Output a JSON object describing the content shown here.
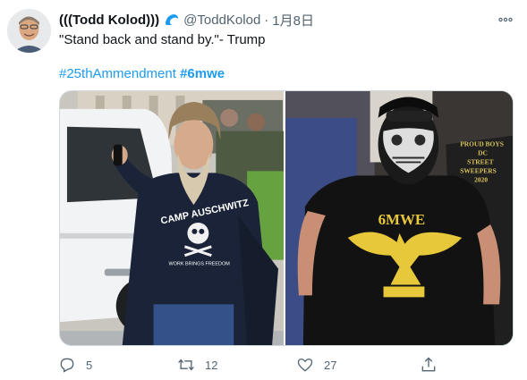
{
  "tweet": {
    "display_name": "(((Todd Kolod)))",
    "handle": "@ToddKolod",
    "separator": "·",
    "date": "1月8日",
    "text": "\"Stand back and stand by.\"- Trump",
    "hashtags": [
      "#25thAmmendment",
      "#6mwe"
    ],
    "more_icon": "more-dots-icon",
    "badge_icon": "wave-emoji-icon"
  },
  "media": {
    "left_photo": {
      "shirt_text_line1": "CAMP AUSCHWITZ",
      "shirt_text_line2": "WORK BRINGS FREEDOM"
    },
    "right_photo": {
      "shirt_text": "6MWE",
      "background_shirt_text": [
        "PROUD BOYS",
        "DC",
        "STREET",
        "SWEEPERS",
        "2020"
      ]
    }
  },
  "actions": {
    "reply_count": "5",
    "retweet_count": "12",
    "like_count": "27"
  },
  "colors": {
    "hashtag": "#1d9bf0",
    "secondary_text": "#536471",
    "primary_text": "#0f1419",
    "badge": "#1d9bf0"
  }
}
